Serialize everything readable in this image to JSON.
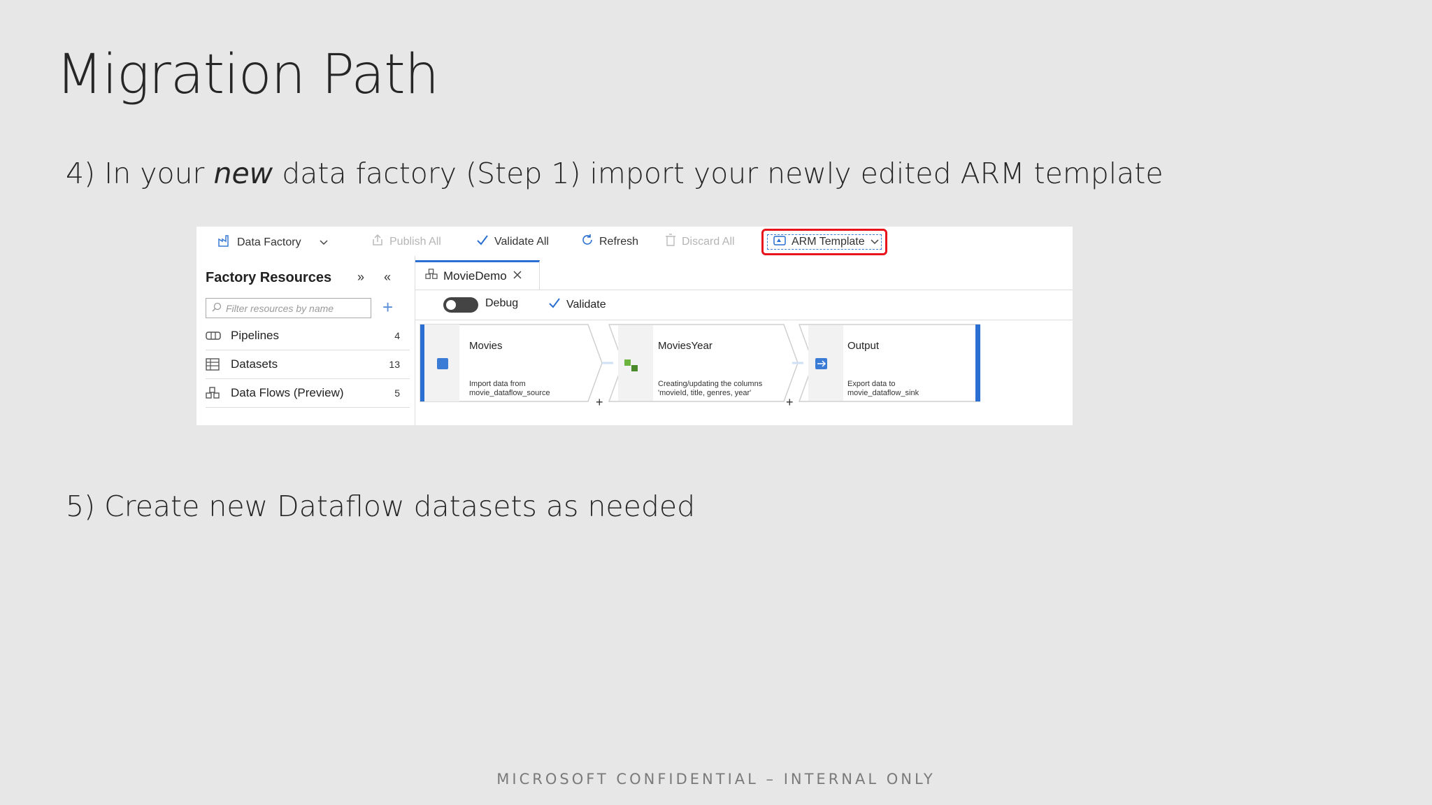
{
  "slide": {
    "title": "Migration Path",
    "step4_prefix": "4) In your ",
    "step4_em": "new",
    "step4_suffix": " data factory (Step 1) import your newly edited ARM template",
    "step5": "5) Create new Dataflow datasets as needed",
    "footer": "MICROSOFT CONFIDENTIAL – INTERNAL  ONLY"
  },
  "toolbar": {
    "data_factory": "Data Factory",
    "publish_all": "Publish All",
    "validate_all": "Validate All",
    "refresh": "Refresh",
    "discard_all": "Discard All",
    "arm_template": "ARM Template"
  },
  "sidebar": {
    "title": "Factory Resources",
    "filter_placeholder": "Filter resources by name",
    "items": [
      {
        "label": "Pipelines",
        "count": "4"
      },
      {
        "label": "Datasets",
        "count": "13"
      },
      {
        "label": "Data Flows (Preview)",
        "count": "5"
      }
    ]
  },
  "editor": {
    "tab": "MovieDemo",
    "debug": "Debug",
    "validate": "Validate"
  },
  "flow": {
    "nodes": [
      {
        "label": "Movies",
        "desc1": "Import data from",
        "desc2": "movie_dataflow_source"
      },
      {
        "label": "MoviesYear",
        "desc1": "Creating/updating the columns",
        "desc2": "'movieId, title, genres, year'"
      },
      {
        "label": "Output",
        "desc1": "Export data to",
        "desc2": "movie_dataflow_sink"
      }
    ]
  },
  "colors": {
    "accent": "#2a6fd1",
    "highlight_border": "#e8141c",
    "background": "#e7e7e7"
  }
}
